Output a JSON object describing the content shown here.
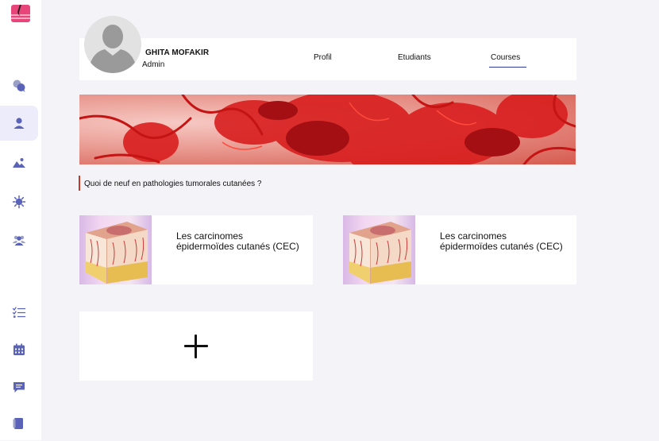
{
  "sidebar": {
    "items": [
      {
        "icon": "chat-bubbles-icon",
        "label": "Messages"
      },
      {
        "icon": "user-icon",
        "label": "Profil",
        "active": true
      },
      {
        "icon": "image-icon",
        "label": "Images"
      },
      {
        "icon": "virus-icon",
        "label": "Pathologies"
      },
      {
        "icon": "users-group-icon",
        "label": "Etudiants"
      },
      {
        "icon": "checklist-icon",
        "label": "Tâches"
      },
      {
        "icon": "calendar-icon",
        "label": "Calendrier"
      },
      {
        "icon": "comment-icon",
        "label": "Commentaires"
      },
      {
        "icon": "book-icon",
        "label": "Cours"
      }
    ]
  },
  "profile": {
    "name": "GHITA MOFAKIR",
    "role": "Admin",
    "tabs": [
      {
        "label": "Profil"
      },
      {
        "label": "Etudiants"
      },
      {
        "label": "Courses",
        "active": true
      }
    ]
  },
  "news": {
    "text": "Quoi de neuf en pathologies tumorales cutanées ?"
  },
  "courses": [
    {
      "title": "Les carcinomes épidermoïdes cutanés (CEC)"
    },
    {
      "title": "Les carcinomes épidermoïdes cutanés (CEC)"
    }
  ],
  "colors": {
    "accent": "#2b3a9c",
    "news_marker": "#c0392b",
    "sidebar_active_bg": "#ececfa",
    "icon_color": "#5a63b8"
  }
}
